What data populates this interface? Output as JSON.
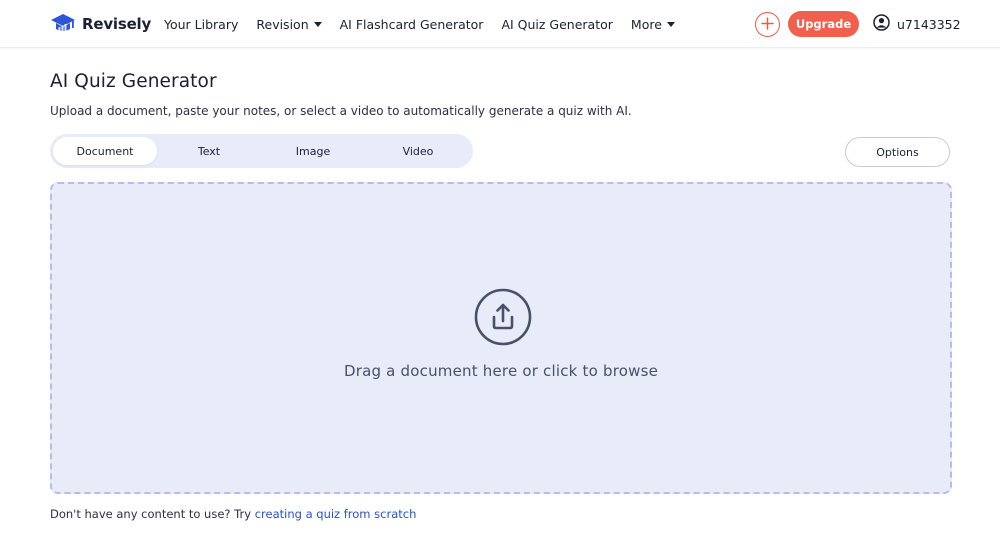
{
  "brand": {
    "name": "Revisely"
  },
  "nav": {
    "items": [
      {
        "label": "Your Library",
        "has_caret": false
      },
      {
        "label": "Revision",
        "has_caret": true
      },
      {
        "label": "AI Flashcard Generator",
        "has_caret": false
      },
      {
        "label": "AI Quiz Generator",
        "has_caret": false
      },
      {
        "label": "More",
        "has_caret": true
      }
    ],
    "upgrade_label": "Upgrade",
    "username": "u7143352"
  },
  "page": {
    "title": "AI Quiz Generator",
    "description": "Upload a document, paste your notes, or select a video to automatically generate a quiz with AI."
  },
  "tabs": [
    {
      "label": "Document",
      "active": true
    },
    {
      "label": "Text",
      "active": false
    },
    {
      "label": "Image",
      "active": false
    },
    {
      "label": "Video",
      "active": false
    }
  ],
  "options_label": "Options",
  "dropzone": {
    "text": "Drag a document here or click to browse",
    "icon": "upload-icon"
  },
  "footer": {
    "prefix": "Don't have any content to use? Try ",
    "link_text": "creating a quiz from scratch"
  },
  "colors": {
    "accent": "#f0604c",
    "brand_blue": "#2d55d8",
    "panel_bg": "#e8ebf8",
    "link": "#2d4fc9"
  }
}
